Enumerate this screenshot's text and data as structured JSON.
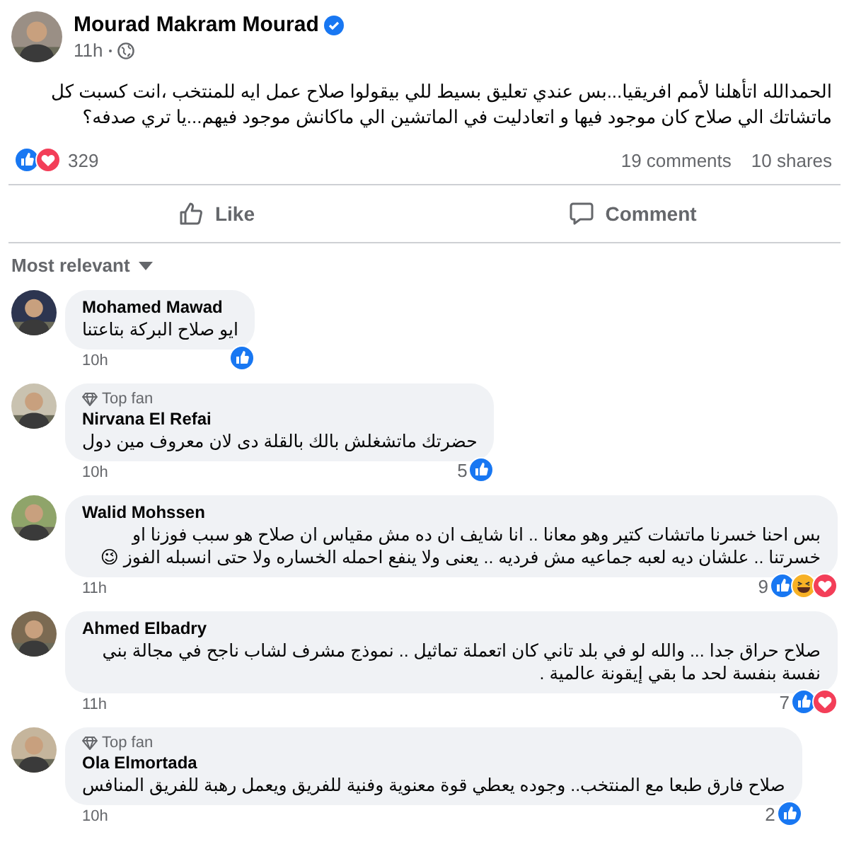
{
  "post": {
    "author": "Mourad Makram Mourad",
    "verified": true,
    "time": "11h",
    "text": "الحمدالله اتأهلنا لأمم افريقيا...بس عندي تعليق بسيط للي بيقولوا صلاح عمل ايه للمنتخب ،انت كسبت كل ماتشاتك الي صلاح كان موجود فيها و اتعادليت في الماتشين الي ماكانش موجود فيهم...يا تري صدفه؟",
    "reactions": [
      {
        "kind": "like"
      },
      {
        "kind": "love"
      }
    ],
    "reaction_count": "329",
    "comments_count": "19 comments",
    "shares_count": "10 shares"
  },
  "actions": {
    "like": {
      "label": "Like"
    },
    "comment": {
      "label": "Comment"
    }
  },
  "sort": {
    "label": "Most relevant"
  },
  "comments": [
    {
      "author": "Mohamed Mawad",
      "text": "ايو صلاح البركة بتاعتنا",
      "time": "10h",
      "reactions": [
        {
          "kind": "like"
        }
      ]
    },
    {
      "author": "Nirvana El Refai",
      "badge": "Top fan",
      "text": "حضرتك ماتشغلش بالك بالقلة دى لان معروف مين دول",
      "time": "10h",
      "count": "5",
      "reactions": [
        {
          "kind": "like"
        }
      ]
    },
    {
      "author": "Walid Mohssen",
      "text": "بس احنا خسرنا ماتشات كتير وهو معانا .. انا شايف ان ده مش مقياس ان صلاح هو سبب فوزنا او خسرتنا .. علشان ديه لعبه جماعيه مش فرديه .. يعنى ولا ينفع احمله الخساره ولا حتى انسبله الفوز 😉",
      "time": "11h",
      "count": "9",
      "reactions": [
        {
          "kind": "like"
        },
        {
          "kind": "haha"
        },
        {
          "kind": "love"
        }
      ]
    },
    {
      "author": "Ahmed Elbadry",
      "text": "صلاح حراق جدا ... والله لو في بلد تاني كان اتعملة تماثيل .. نموذج مشرف لشاب ناجح في مجالة بني نفسة بنفسة لحد ما بقي إيقونة عالمية .",
      "time": "11h",
      "count": "7",
      "reactions": [
        {
          "kind": "like"
        },
        {
          "kind": "love"
        }
      ]
    },
    {
      "author": "Ola Elmortada",
      "badge": "Top fan",
      "text": "صلاح فارق طبعا مع المنتخب.. وجوده يعطي قوة معنوية وفنية للفريق ويعمل رهبة للفريق المنافس",
      "time": "10h",
      "count": "2",
      "reactions": [
        {
          "kind": "like"
        }
      ]
    }
  ]
}
